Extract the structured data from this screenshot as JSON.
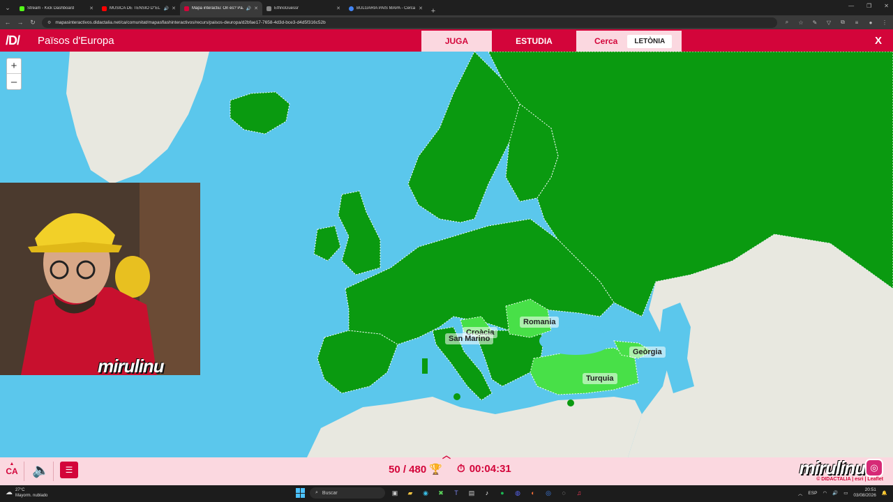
{
  "browser": {
    "tabs": [
      {
        "title": "Stream - Kick Dashboard",
        "color": "#53fc18",
        "active": false,
        "sound": false
      },
      {
        "title": "MÚSICA DE TENSIÓ D''EL ...",
        "color": "#ff0000",
        "active": false,
        "sound": true
      },
      {
        "title": "Mapa interactiu: On és? Pa...",
        "color": "#d3053a",
        "active": true,
        "sound": true
      },
      {
        "title": "EthnoGuessr",
        "color": "#888888",
        "active": false,
        "sound": false
      },
      {
        "title": "BULGARIA PAIS MAPA - Cerca a...",
        "color": "#4285f4",
        "active": false,
        "sound": false
      }
    ],
    "url": "mapasinteractivos.didactalia.net/ca/comunitat/mapasflashinteractivos/recurs/paisos-deuropa/d2bfae17-7658-4d3d-bce3-d4d5f316c52b"
  },
  "app": {
    "logo": "/D/",
    "title": "Països d'Europa",
    "juga_label": "JUGA",
    "estudia_label": "ESTUDIA",
    "cerca_label": "Cerca",
    "target_country": "LETÒNIA",
    "close_label": "X"
  },
  "map": {
    "zoom_in": "+",
    "zoom_out": "–",
    "labels": {
      "romania": "Romania",
      "croacia": "Croàcia",
      "san_marino": "San Marino",
      "georgia": "Geòrgia",
      "turquia": "Turquia"
    },
    "colors": {
      "sea": "#5bc7ec",
      "done": "#0a9a10",
      "recent": "#48e048",
      "land": "#e8e8e0"
    }
  },
  "streamer": {
    "name": "mirulinu"
  },
  "footer": {
    "language": "CA",
    "score": "50 / 480",
    "time": "00:04:31",
    "brand": "mirulinu",
    "credits": "© DIDACTALIA | esri | Leaflet"
  },
  "taskbar": {
    "temp": "27°C",
    "weather": "Mayorm. nublado",
    "search": "Buscar",
    "lang": "ESP",
    "time": "20:51",
    "date": "03/08/2026"
  }
}
